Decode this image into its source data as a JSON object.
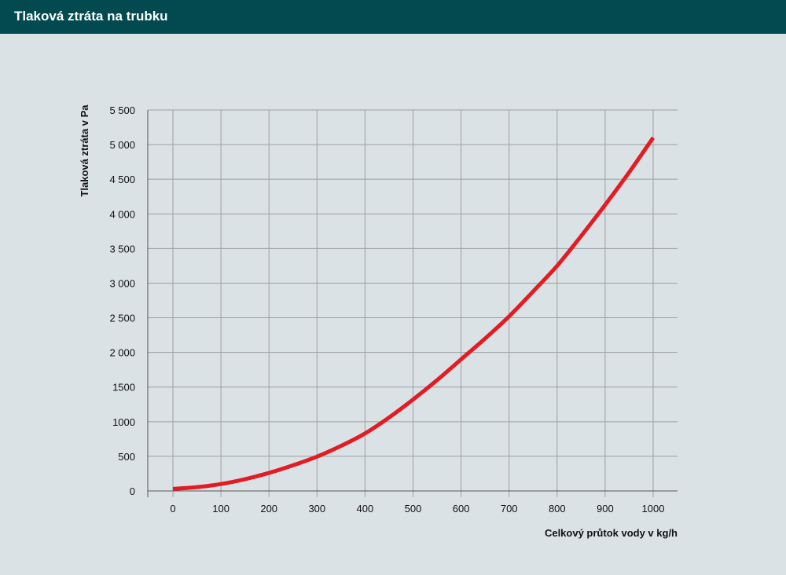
{
  "header": {
    "title": "Tlaková ztráta na trubku"
  },
  "colors": {
    "header_bg": "#024a4f",
    "background": "#dbe2e5",
    "grid": "#9a9fa2",
    "series": "#e31b23"
  },
  "chart_data": {
    "type": "line",
    "title": "",
    "xlabel": "Celkový průtok vody v kg/h",
    "ylabel": "Tlaková ztráta v Pa",
    "xlim": [
      0,
      1000
    ],
    "ylim": [
      0,
      5500
    ],
    "grid": true,
    "x_ticks": [
      0,
      100,
      200,
      300,
      400,
      500,
      600,
      700,
      800,
      900,
      1000
    ],
    "x_tick_labels": [
      "0",
      "100",
      "200",
      "300",
      "400",
      "500",
      "600",
      "700",
      "800",
      "900",
      "1000"
    ],
    "y_ticks": [
      0,
      500,
      1000,
      1500,
      2000,
      2500,
      3000,
      3500,
      4000,
      4500,
      5000,
      5500
    ],
    "y_tick_labels": [
      "0",
      "500",
      "1000",
      "1500",
      "2 000",
      "2 500",
      "3 000",
      "3 500",
      "4 000",
      "4 500",
      "5 000",
      "5 500"
    ],
    "series": [
      {
        "x": [
          0,
          50,
          100,
          150,
          200,
          250,
          300,
          350,
          400,
          450,
          500,
          550,
          600,
          650,
          700,
          750,
          800,
          850,
          900,
          950,
          1000
        ],
        "y": [
          30,
          55,
          100,
          170,
          260,
          370,
          495,
          650,
          830,
          1060,
          1320,
          1600,
          1900,
          2200,
          2520,
          2880,
          3250,
          3680,
          4130,
          4600,
          5100
        ]
      }
    ]
  }
}
